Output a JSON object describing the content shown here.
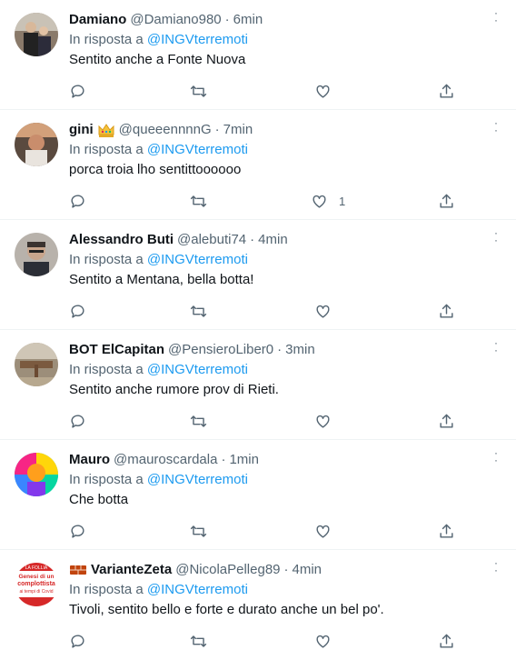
{
  "reply_prefix": "In risposta a",
  "tweets": [
    {
      "name": "Damiano",
      "handle": "@Damiano980",
      "time": "6min",
      "mention": "@INGVterremoti",
      "text": "Sentito anche a Fonte Nuova",
      "likes": ""
    },
    {
      "name": "gini",
      "handle": "@queeennnnG",
      "time": "7min",
      "mention": "@INGVterremoti",
      "text": "porca troia lho sentittoooooo",
      "likes": "1"
    },
    {
      "name": "Alessandro Buti",
      "handle": "@alebuti74",
      "time": "4min",
      "mention": "@INGVterremoti",
      "text": "Sentito a Mentana, bella botta!",
      "likes": ""
    },
    {
      "name": "BOT ElCapitan",
      "handle": "@PensieroLiber0",
      "time": "3min",
      "mention": "@INGVterremoti",
      "text": "Sentito anche rumore prov di Rieti.",
      "likes": ""
    },
    {
      "name": "Mauro",
      "handle": "@mauroscardala",
      "time": "1min",
      "mention": "@INGVterremoti",
      "text": "Che botta",
      "likes": ""
    },
    {
      "name": "VarianteZeta",
      "handle": "@NicolaPelleg89",
      "time": "4min",
      "mention": "@INGVterremoti",
      "text": "Tivoli, sentito bello e forte e durato anche un bel po'.",
      "likes": "",
      "avatar_text": [
        "LA FOLLIA",
        "Genesi di un",
        "complottista",
        "ai tempi di Covid"
      ]
    }
  ],
  "icons": {
    "reply": "comment-icon",
    "retweet": "retweet-icon",
    "like": "heart-icon",
    "share": "share-icon",
    "more": "more-icon"
  },
  "colors": {
    "accent": "#1d9bf0",
    "secondary_text": "#536471",
    "divider": "#eff3f4"
  }
}
